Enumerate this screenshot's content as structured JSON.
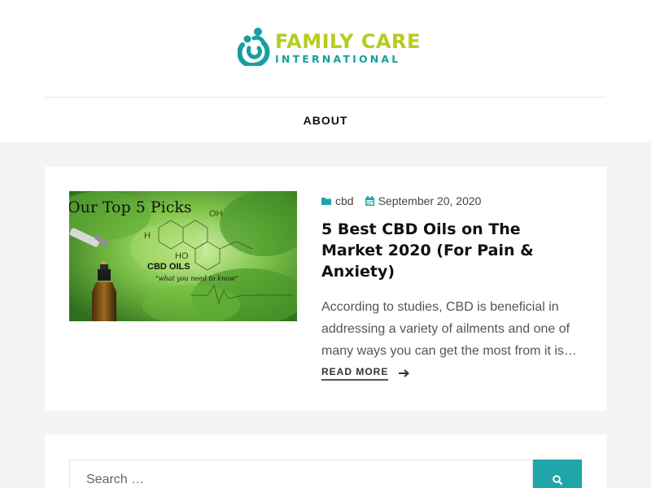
{
  "colors": {
    "brand_teal": "#179ea0",
    "brand_lime": "#b6cc1e",
    "accent": "#21a5a8"
  },
  "header": {
    "logo_line1": "FAMILY CARE",
    "logo_line2": "INTERNATIONAL",
    "logo_icon": "family-hug-icon"
  },
  "nav": {
    "items": [
      {
        "label": "ABOUT"
      }
    ]
  },
  "post": {
    "image_text": {
      "heading": "Our Top 5 Picks",
      "label": "CBD OILS",
      "tagline": "\"what you need to know\"",
      "molecule_1": "OH",
      "molecule_2": "H",
      "molecule_3": "HO"
    },
    "category": "cbd",
    "category_icon": "folder-icon",
    "date": "September 20, 2020",
    "date_icon": "calendar-icon",
    "title": "5 Best CBD Oils on The Market 2020 (For Pain & Anxiety)",
    "excerpt": "According to studies, CBD is beneficial in addressing a variety of ailments and one of many ways you can get the most from it is…",
    "read_more": "READ MORE",
    "read_more_icon": "arrow-right-icon"
  },
  "search": {
    "placeholder": "Search …",
    "button_icon": "search-icon"
  }
}
